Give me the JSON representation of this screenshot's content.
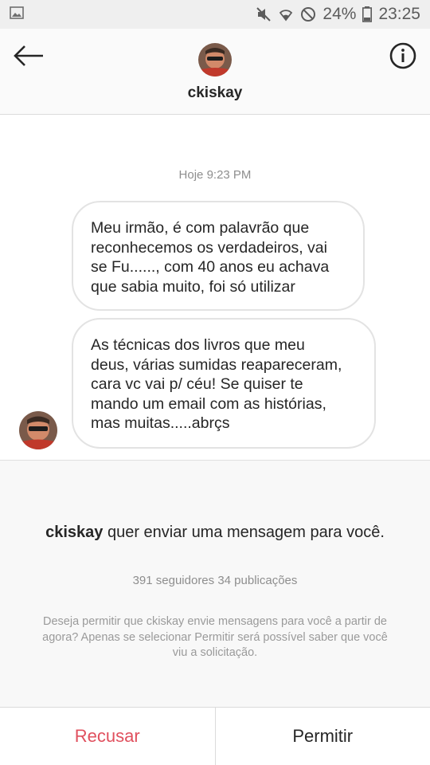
{
  "status_bar": {
    "battery": "24%",
    "time": "23:25",
    "icons": [
      "image-icon",
      "mute-icon",
      "wifi-icon",
      "block-icon",
      "battery-icon"
    ]
  },
  "header": {
    "username": "ckiskay",
    "back_icon": "arrow-left-icon",
    "info_icon": "info-circle-icon"
  },
  "conversation": {
    "timestamp": "Hoje 9:23 PM",
    "messages": [
      {
        "lines": [
          "Meu irmão, é com palavrão que",
          "reconhecemos os verdadeiros, vai",
          "se Fu......, com 40 anos eu achava",
          "que sabia muito, foi só utilizar"
        ]
      },
      {
        "lines": [
          "As técnicas dos livros que meu",
          "deus, várias sumidas reapareceram,",
          "cara vc vai p/ céu! Se quiser te",
          "mando um email com as histórias,",
          "mas muitas.....abrçs"
        ]
      }
    ]
  },
  "request": {
    "username": "ckiskay",
    "title_suffix": " quer enviar uma mensagem para você.",
    "stats": "391 seguidores 34 publicações",
    "description": "Deseja permitir que ckiskay envie mensagens para você a partir de agora? Apenas se selecionar Permitir será possível saber que você viu a solicitação."
  },
  "actions": {
    "decline_label": "Recusar",
    "accept_label": "Permitir"
  },
  "colors": {
    "decline": "#e0505e",
    "text": "#262626",
    "muted": "#8e8e8e"
  }
}
